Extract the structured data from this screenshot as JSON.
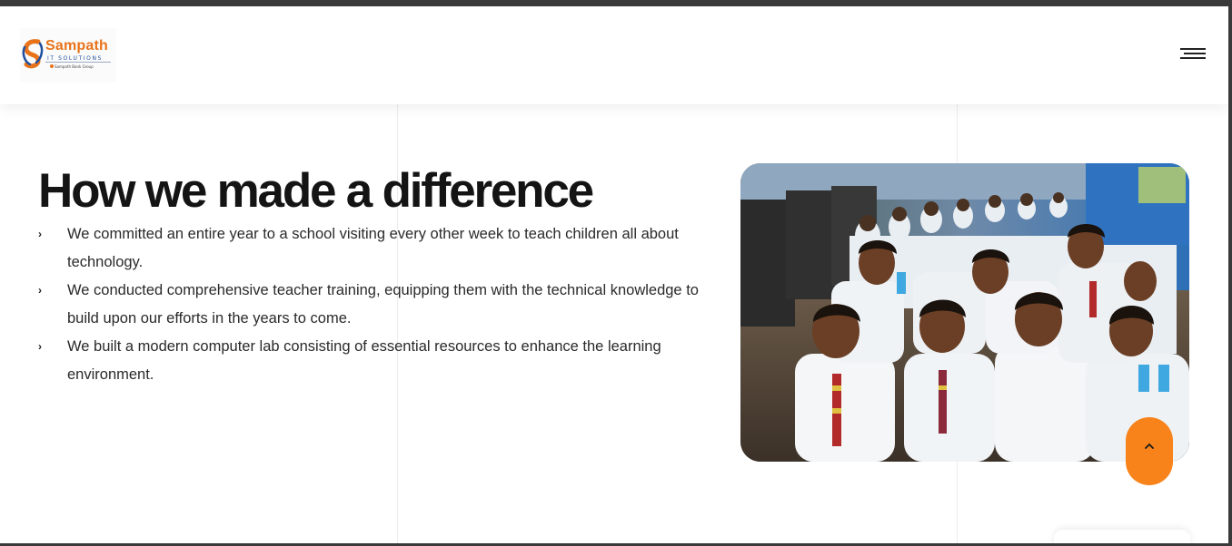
{
  "brand": {
    "name": "Sampath",
    "subtitle": "IT SOLUTIONS",
    "group": "Sampath Bank Group",
    "primary_color": "#e8731a",
    "secondary_color": "#1e4fa0"
  },
  "header": {
    "menu_icon": "hamburger-menu-icon"
  },
  "section": {
    "title": "How we made a difference",
    "items": [
      {
        "text": "We committed an entire year to a school visiting every other week to teach children all about technology."
      },
      {
        "text": "We conducted comprehensive teacher training, equipping them with the technical knowledge to build upon our efforts in the years to come."
      },
      {
        "text": "We built a modern computer lab consisting of essential resources to enhance the learning environment."
      }
    ],
    "bullet_icon": "chevron-right-icon"
  },
  "scroll_top": {
    "icon": "chevron-up-icon",
    "color": "#f7831a"
  }
}
